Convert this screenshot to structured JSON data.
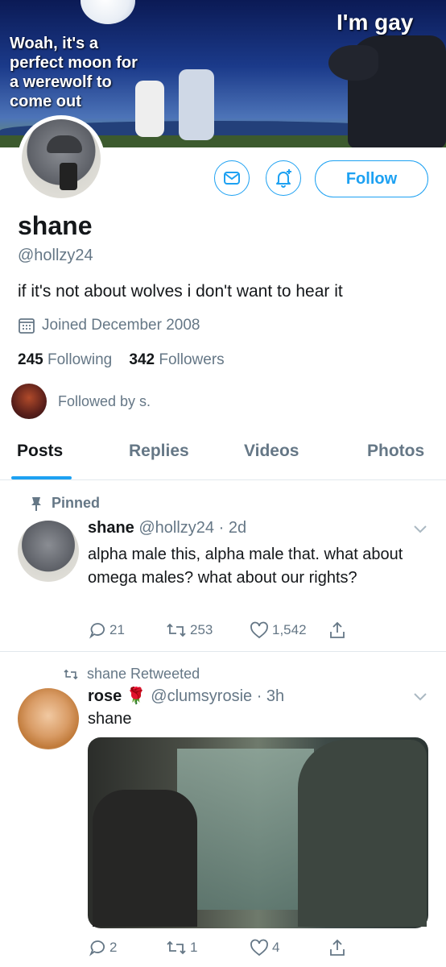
{
  "banner": {
    "left_text": "Woah, it's a perfect moon for a werewolf to come out",
    "right_text": "I'm gay"
  },
  "profile": {
    "name": "shane",
    "handle": "@hollzy24",
    "bio": "if it's not about wolves i don't want to hear it",
    "joined": "Joined December 2008",
    "following_count": "245",
    "following_label": "Following",
    "followers_count": "342",
    "followers_label": "Followers",
    "followed_by": "Followed by s."
  },
  "actions": {
    "follow_label": "Follow"
  },
  "tabs": [
    {
      "label": "Posts"
    },
    {
      "label": "Replies"
    },
    {
      "label": "Videos"
    },
    {
      "label": "Photos"
    }
  ],
  "tweets": [
    {
      "pinned_label": "Pinned",
      "name": "shane",
      "handle_time": "@hollzy24 · 2d",
      "text": "alpha male this, alpha male that. what about omega males? what about our rights?",
      "replies": "21",
      "retweets": "253",
      "likes": "1,542"
    },
    {
      "retweet_label": "shane Retweeted",
      "name": "rose",
      "emoji": "🌹",
      "handle_time": "@clumsyrosie · 3h",
      "text": "shane",
      "replies": "2",
      "retweets": "1",
      "likes": "4"
    }
  ],
  "colors": {
    "accent": "#1da1f2",
    "secondary_text": "#657786",
    "divider": "#e1e8ed"
  }
}
